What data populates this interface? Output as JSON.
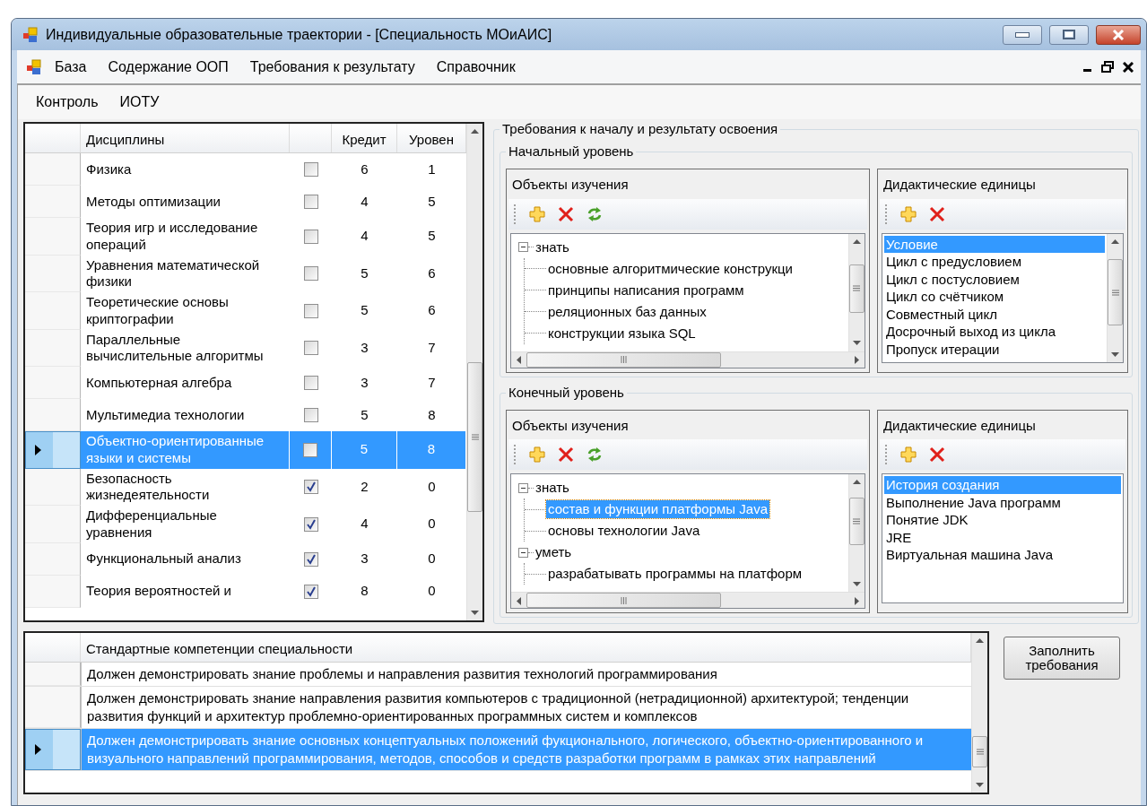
{
  "window": {
    "title": "Индивидуальные образовательные траектории - [Специальность МОиАИС]"
  },
  "menu": [
    {
      "label": "База"
    },
    {
      "label": "Содержание ООП"
    },
    {
      "label": "Требования к результату"
    },
    {
      "label": "Справочник"
    }
  ],
  "submenu": [
    {
      "label": "Контроль"
    },
    {
      "label": "ИОТУ"
    }
  ],
  "disciplines": {
    "columns": {
      "name": "Дисциплины",
      "credit": "Кредит",
      "level": "Уровен"
    },
    "rows": [
      {
        "name": "Физика",
        "checked": false,
        "credit": "6",
        "level": "1",
        "selected": false
      },
      {
        "name": "Методы оптимизации",
        "checked": false,
        "credit": "4",
        "level": "5",
        "selected": false
      },
      {
        "name": "Теория игр и исследование операций",
        "checked": false,
        "credit": "4",
        "level": "5",
        "selected": false
      },
      {
        "name": "Уравнения математической физики",
        "checked": false,
        "credit": "5",
        "level": "6",
        "selected": false
      },
      {
        "name": "Теоретические основы криптографии",
        "checked": false,
        "credit": "5",
        "level": "6",
        "selected": false
      },
      {
        "name": "Параллельные вычислительные алгоритмы",
        "checked": false,
        "credit": "3",
        "level": "7",
        "selected": false
      },
      {
        "name": "Компьютерная алгебра",
        "checked": false,
        "credit": "3",
        "level": "7",
        "selected": false
      },
      {
        "name": "Мультимедиа технологии",
        "checked": false,
        "credit": "5",
        "level": "8",
        "selected": false
      },
      {
        "name": "Объектно-ориентированные языки и системы",
        "checked": false,
        "credit": "5",
        "level": "8",
        "selected": true
      },
      {
        "name": "Безопасность жизнедеятельности",
        "checked": true,
        "credit": "2",
        "level": "0",
        "selected": false
      },
      {
        "name": "Дифференциальные уравнения",
        "checked": true,
        "credit": "4",
        "level": "0",
        "selected": false
      },
      {
        "name": "Функциональный анализ",
        "checked": true,
        "credit": "3",
        "level": "0",
        "selected": false
      },
      {
        "name": "Теория вероятностей и",
        "checked": true,
        "credit": "8",
        "level": "0",
        "selected": false
      }
    ]
  },
  "requirements": {
    "title": "Требования к началу и результату освоения",
    "initial": {
      "title": "Начальный уровень",
      "objects": {
        "title": "Объекты изучения",
        "tree": [
          {
            "label": "знать",
            "expanded": true,
            "selected": false,
            "children": [
              {
                "label": "основные алгоритмические конструкци",
                "selected": false
              },
              {
                "label": "принципы написания программ",
                "selected": false
              },
              {
                "label": "реляционных баз данных",
                "selected": false
              },
              {
                "label": "конструкции языка SQL",
                "selected": false
              }
            ]
          }
        ]
      },
      "units": {
        "title": "Дидактические единицы",
        "items": [
          {
            "label": "Условие",
            "selected": true
          },
          {
            "label": "Цикл с предусловием",
            "selected": false
          },
          {
            "label": "Цикл с постусловием",
            "selected": false
          },
          {
            "label": "Цикл со счётчиком",
            "selected": false
          },
          {
            "label": "Совместный цикл",
            "selected": false
          },
          {
            "label": "Досрочный выход из цикла",
            "selected": false
          },
          {
            "label": "Пропуск итерации",
            "selected": false
          }
        ]
      }
    },
    "final": {
      "title": "Конечный уровень",
      "objects": {
        "title": "Объекты изучения",
        "tree": [
          {
            "label": "знать",
            "expanded": true,
            "selected": false,
            "children": [
              {
                "label": "состав и функции платформы Java",
                "selected": true
              },
              {
                "label": "основы технологии Java",
                "selected": false
              }
            ]
          },
          {
            "label": "уметь",
            "expanded": true,
            "selected": false,
            "children": [
              {
                "label": "разрабатывать программы на платформ",
                "selected": false
              }
            ]
          }
        ]
      },
      "units": {
        "title": "Дидактические единицы",
        "items": [
          {
            "label": "История создания",
            "selected": true
          },
          {
            "label": "Выполнение Java программ",
            "selected": false
          },
          {
            "label": "Понятие JDK",
            "selected": false
          },
          {
            "label": "JRE",
            "selected": false
          },
          {
            "label": "Виртуальная машина Java",
            "selected": false
          }
        ]
      }
    }
  },
  "competencies": {
    "column": "Стандартные компетенции специальности",
    "rows": [
      {
        "text": "Должен демонстрировать знание проблемы и направления развития технологий программирования",
        "selected": false
      },
      {
        "text": "Должен демонстрировать знание направления развития компьютеров с традиционной (нетрадиционной) архитектурой; тенденции развития функций и архитектур проблемно-ориентированных программных систем и комплексов",
        "selected": false
      },
      {
        "text": "Должен демонстрировать знание основных концептуальных положений фукционального, логического, объектно-ориентированного и визуального направлений программирования, методов, способов и средств разработки программ в рамках этих направлений",
        "selected": true
      }
    ]
  },
  "fill_button": {
    "label": "Заполнить требования"
  }
}
